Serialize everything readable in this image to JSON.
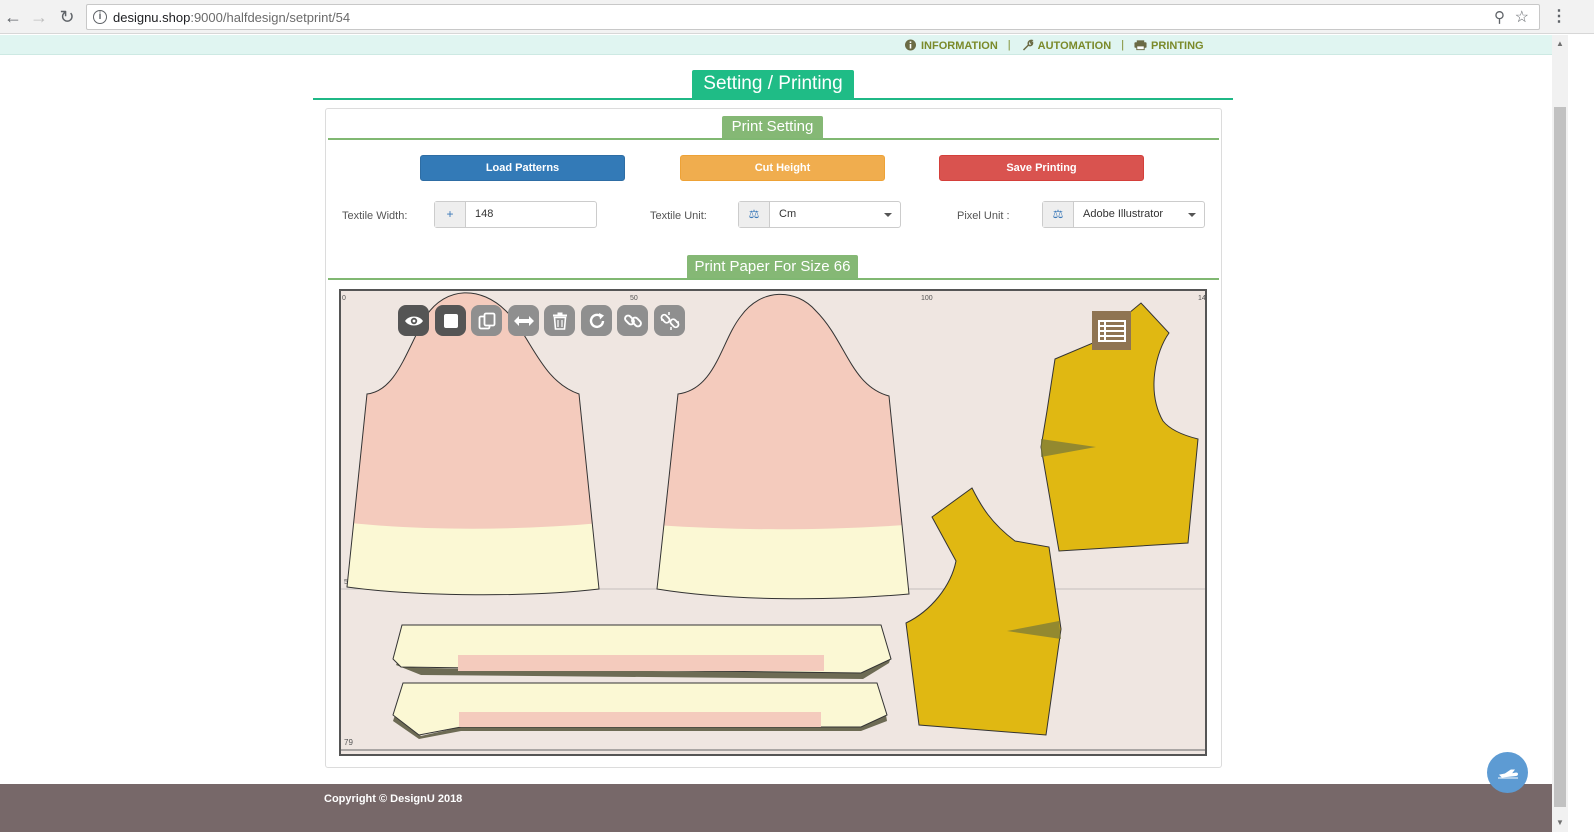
{
  "browser": {
    "url_host": "designu.shop",
    "url_path": ":9000/halfdesign/setprint/54"
  },
  "top_nav": {
    "items": [
      {
        "label": "INFORMATION",
        "icon": "info-icon"
      },
      {
        "label": "AUTOMATION",
        "icon": "wrench-icon"
      },
      {
        "label": "PRINTING",
        "icon": "printer-icon"
      }
    ],
    "separator": "|"
  },
  "page": {
    "title": "Setting / Printing"
  },
  "print_setting": {
    "heading": "Print Setting",
    "load_patterns_label": "Load Patterns",
    "cut_height_label": "Cut Height",
    "save_printing_label": "Save Printing",
    "textile_width_label": "Textile Width:",
    "textile_width_value": "148",
    "textile_unit_label": "Textile Unit:",
    "textile_unit_value": "Cm",
    "pixel_unit_label": "Pixel Unit :",
    "pixel_unit_value": "Adobe Illustrator"
  },
  "print_paper": {
    "heading": "Print Paper For Size 66",
    "ruler_labels": {
      "top": [
        "0",
        "50",
        "100",
        "14"
      ],
      "left": [
        "50",
        "79"
      ]
    },
    "toolbar": [
      "eye-icon",
      "square-icon",
      "copy-icon",
      "flip-horizontal-icon",
      "trash-icon",
      "rotate-icon",
      "link-icon",
      "unlink-icon"
    ],
    "layers_icon": "list-icon",
    "colors": {
      "paper_bg": "#efe6e1",
      "pink": "#f4cbbd",
      "cream": "#fbf8d4",
      "gold": "#e0b812",
      "shadow": "#6d6b54"
    }
  },
  "footer": {
    "copyright": "Copyright © DesignU 2018"
  },
  "theme": {
    "accent": "#1fbc86",
    "section_green": "#85b875",
    "footer_bg": "#776869"
  }
}
